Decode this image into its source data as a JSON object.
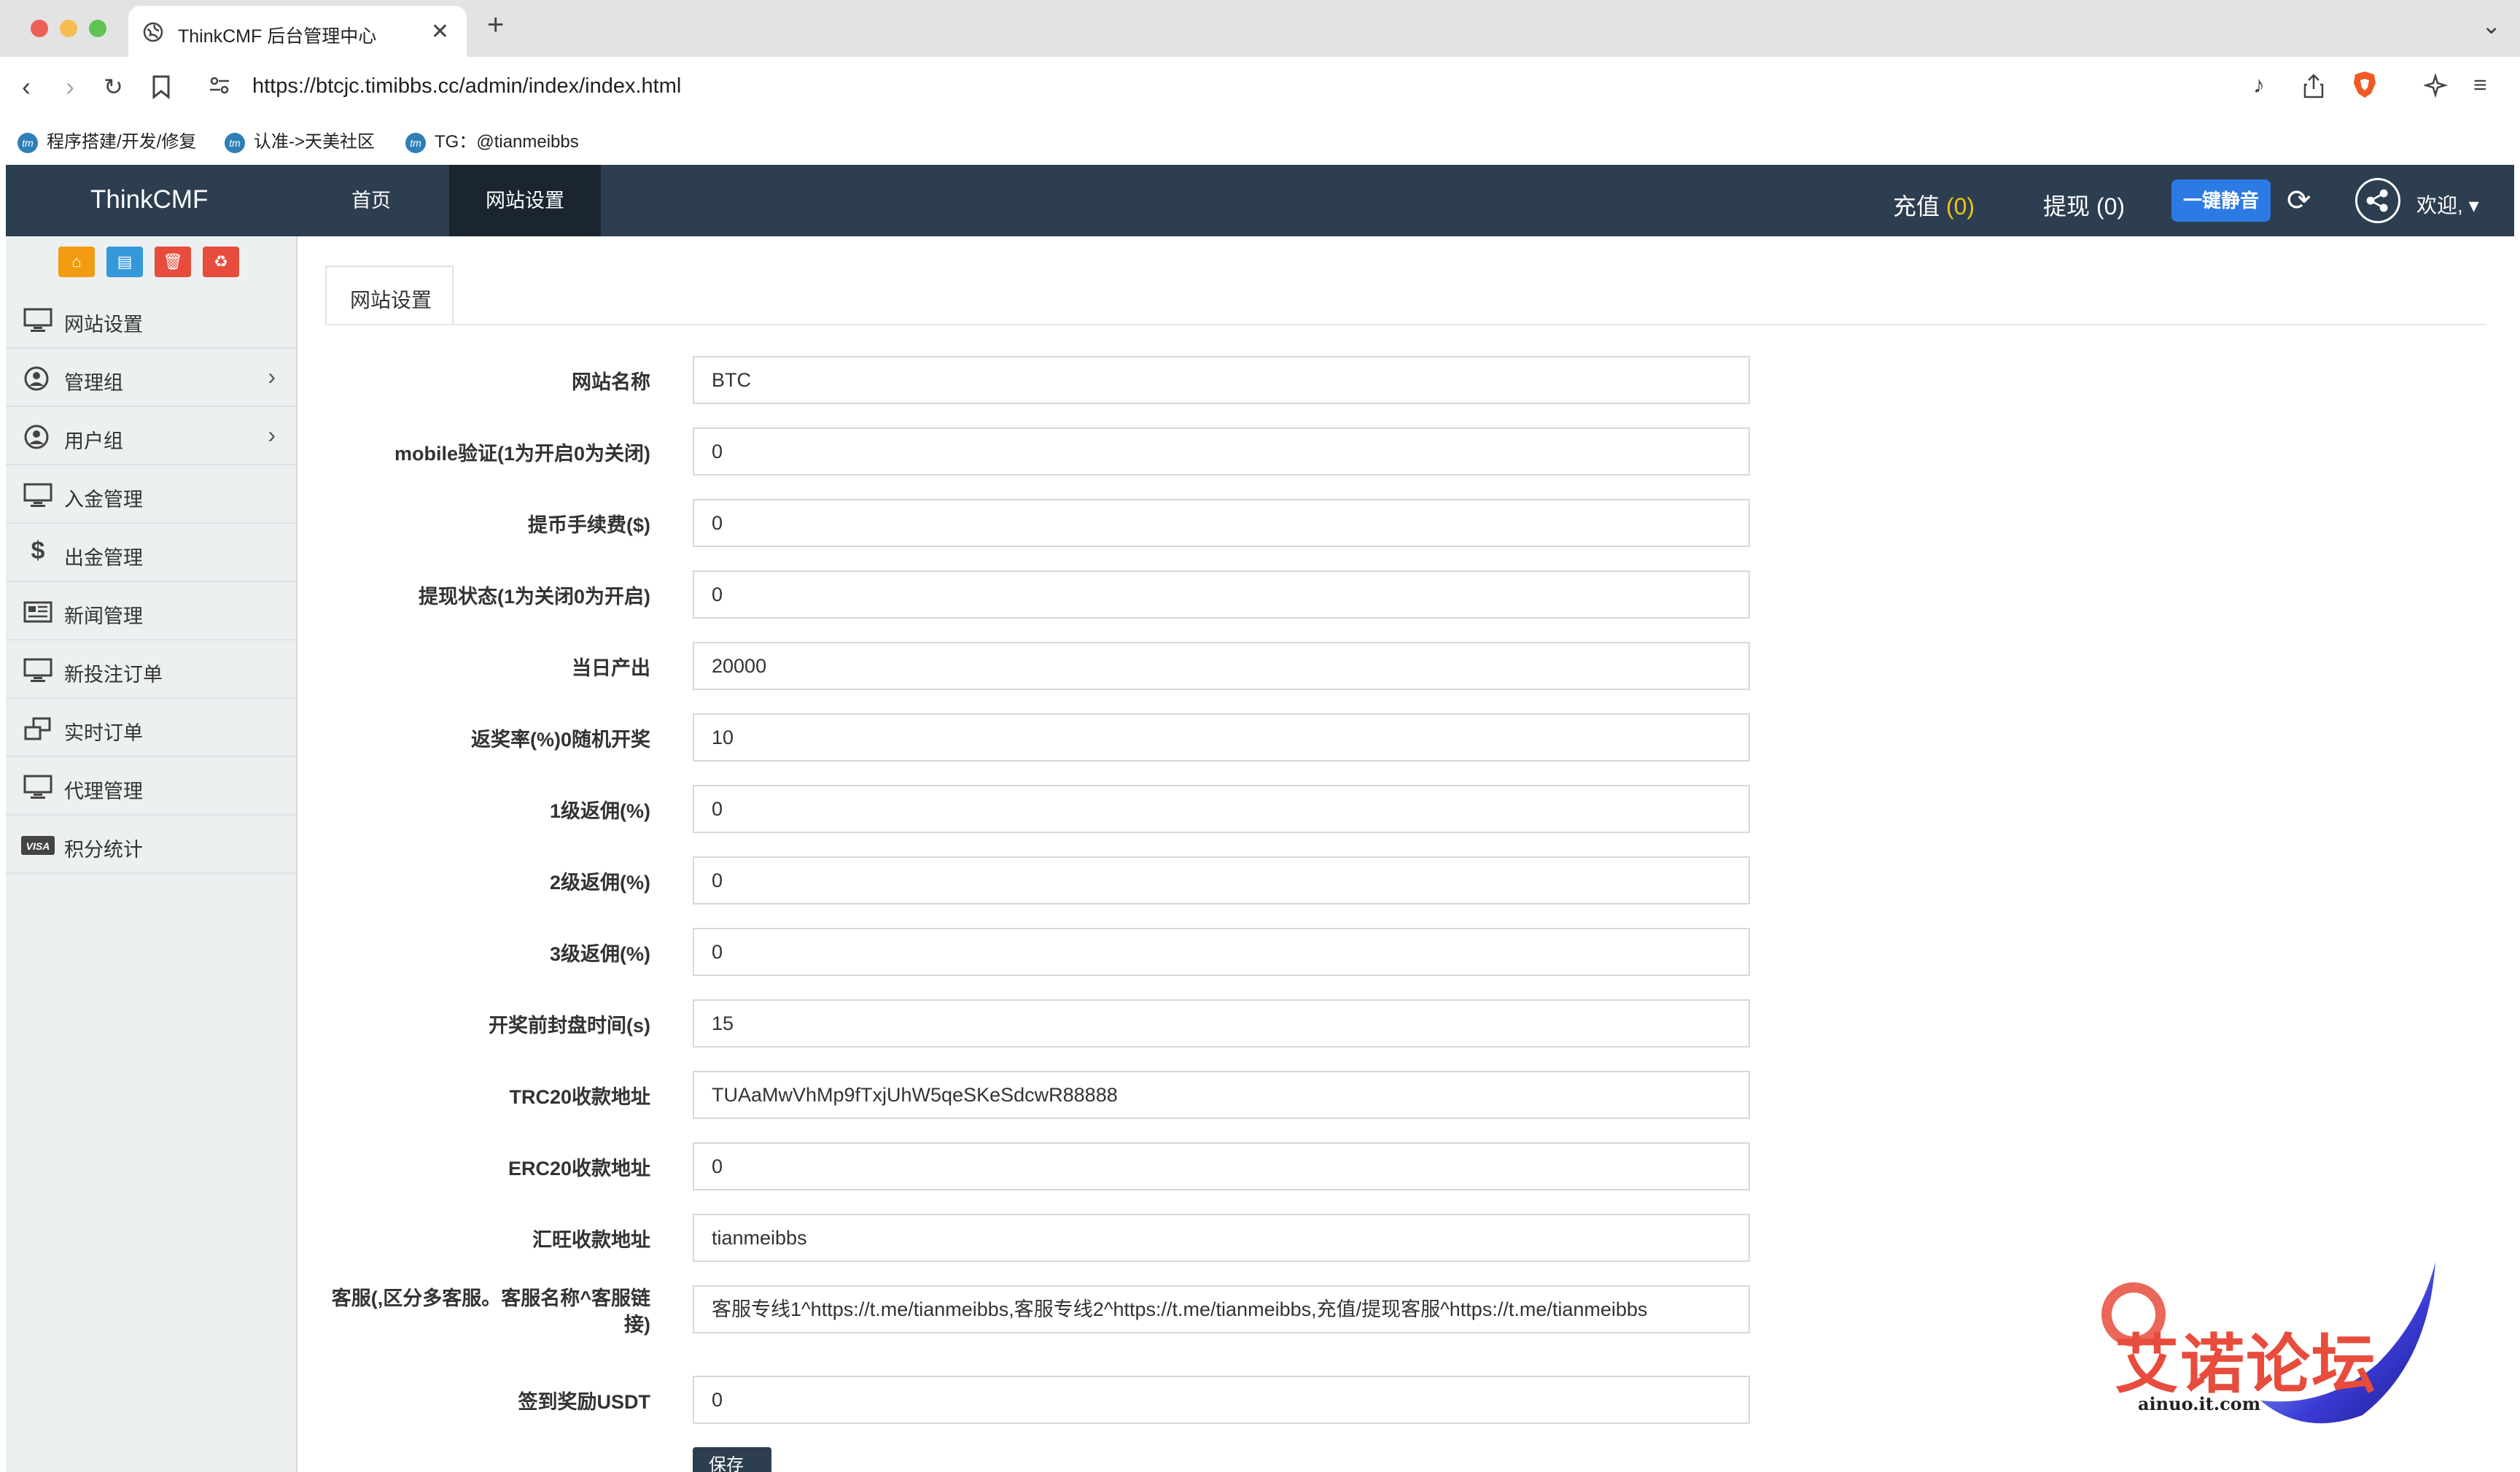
{
  "browser": {
    "tab_title": "ThinkCMF 后台管理中心",
    "url": "https://btcjc.timibbs.cc/admin/index/index.html",
    "bookmarks": [
      "程序搭建/开发/修复",
      "认准->天美社区",
      "TG：@tianmeibbs"
    ]
  },
  "header": {
    "brand": "ThinkCMF",
    "nav": [
      "首页",
      "网站设置"
    ],
    "recharge_label": "充值",
    "recharge_count": "(0)",
    "withdraw_label": "提现",
    "withdraw_count": "(0)",
    "mute_button": "一键静音",
    "welcome": "欢迎,"
  },
  "sidebar": {
    "items": [
      {
        "label": "网站设置",
        "icon": "monitor-icon"
      },
      {
        "label": "管理组",
        "icon": "user-circle-icon",
        "has_children": true
      },
      {
        "label": "用户组",
        "icon": "user-circle-icon",
        "has_children": true
      },
      {
        "label": "入金管理",
        "icon": "monitor-icon"
      },
      {
        "label": "出金管理",
        "icon": "dollar-icon"
      },
      {
        "label": "新闻管理",
        "icon": "newspaper-icon"
      },
      {
        "label": "新投注订单",
        "icon": "monitor-icon"
      },
      {
        "label": "实时订单",
        "icon": "windows-icon"
      },
      {
        "label": "代理管理",
        "icon": "monitor-icon"
      },
      {
        "label": "积分统计",
        "icon": "visa-icon"
      }
    ]
  },
  "main": {
    "tab": "网站设置",
    "fields": [
      {
        "label": "网站名称",
        "value": "BTC"
      },
      {
        "label": "mobile验证(1为开启0为关闭)",
        "value": "0"
      },
      {
        "label": "提币手续费($)",
        "value": "0"
      },
      {
        "label": "提现状态(1为关闭0为开启)",
        "value": "0"
      },
      {
        "label": "当日产出",
        "value": "20000"
      },
      {
        "label": "返奖率(%)0随机开奖",
        "value": "10"
      },
      {
        "label": "1级返佣(%)",
        "value": "0"
      },
      {
        "label": "2级返佣(%)",
        "value": "0"
      },
      {
        "label": "3级返佣(%)",
        "value": "0"
      },
      {
        "label": "开奖前封盘时间(s)",
        "value": "15"
      },
      {
        "label": "TRC20收款地址",
        "value": "TUAaMwVhMp9fTxjUhW5qeSKeSdcwR88888"
      },
      {
        "label": "ERC20收款地址",
        "value": "0"
      },
      {
        "label": "汇旺收款地址",
        "value": "tianmeibbs"
      },
      {
        "label": "客服(,区分多客服。客服名称^客服链接)",
        "value": "客服专线1^https://t.me/tianmeibbs,客服专线2^https://t.me/tianmeibbs,充值/提现客服^https://t.me/tianmeibbs"
      },
      {
        "label": "签到奖励USDT",
        "value": "0"
      }
    ],
    "save_button": "保存"
  },
  "watermark": {
    "title": "艾诺论坛",
    "subtitle": "ainuo.it.com"
  }
}
